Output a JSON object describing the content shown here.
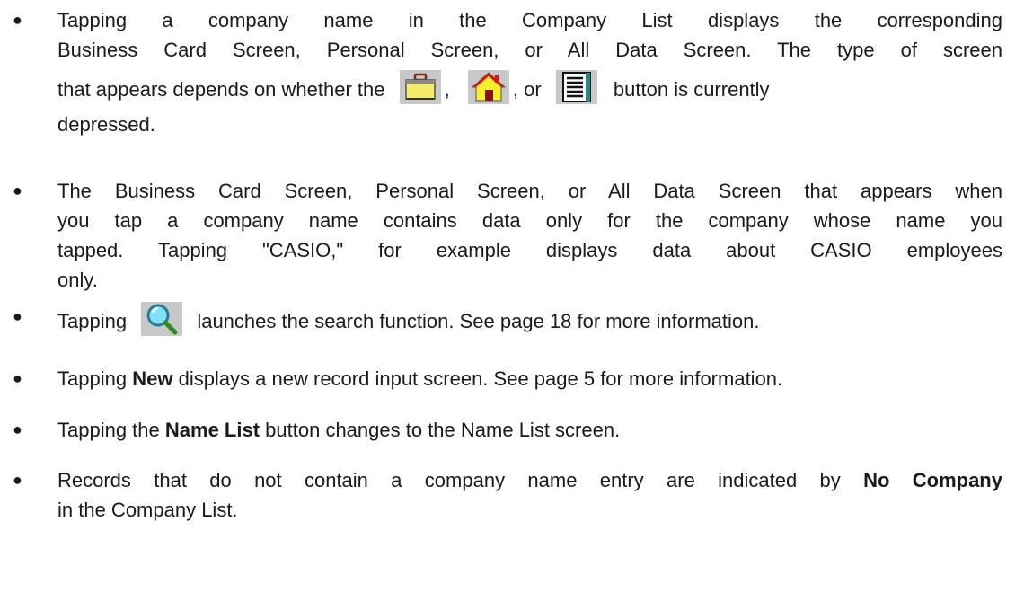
{
  "bullets": [
    {
      "line1": "Tapping a company name in the Company List displays the corresponding",
      "line2": "Business Card Screen, Personal Screen, or All Data Screen. The type of screen",
      "line3a": "that appears depends on whether the",
      "sep1": ",",
      "sep2": ", or",
      "line3b": "button is currently",
      "line4": "depressed."
    },
    {
      "line1": "The Business Card Screen, Personal Screen, or All Data Screen that appears when",
      "line2": "you tap a company name contains data only for the company whose name you",
      "line3": "tapped. Tapping \"CASIO,\" for example displays data about CASIO employees",
      "line4": "only."
    },
    {
      "pre": "Tapping",
      "post": "launches the search function. See page 18 for more information."
    },
    {
      "pre": "Tapping",
      "bold": "New",
      "post": "displays a new record input screen. See page 5 for more information."
    },
    {
      "pre": "Tapping the",
      "bold": "Name List",
      "post": "button changes to the Name List screen."
    },
    {
      "line1_pre": "Records that do not contain a company name entry are indicated by",
      "bold": "No Company",
      "line2": "in the Company List."
    }
  ],
  "bullet_glyph": "●"
}
